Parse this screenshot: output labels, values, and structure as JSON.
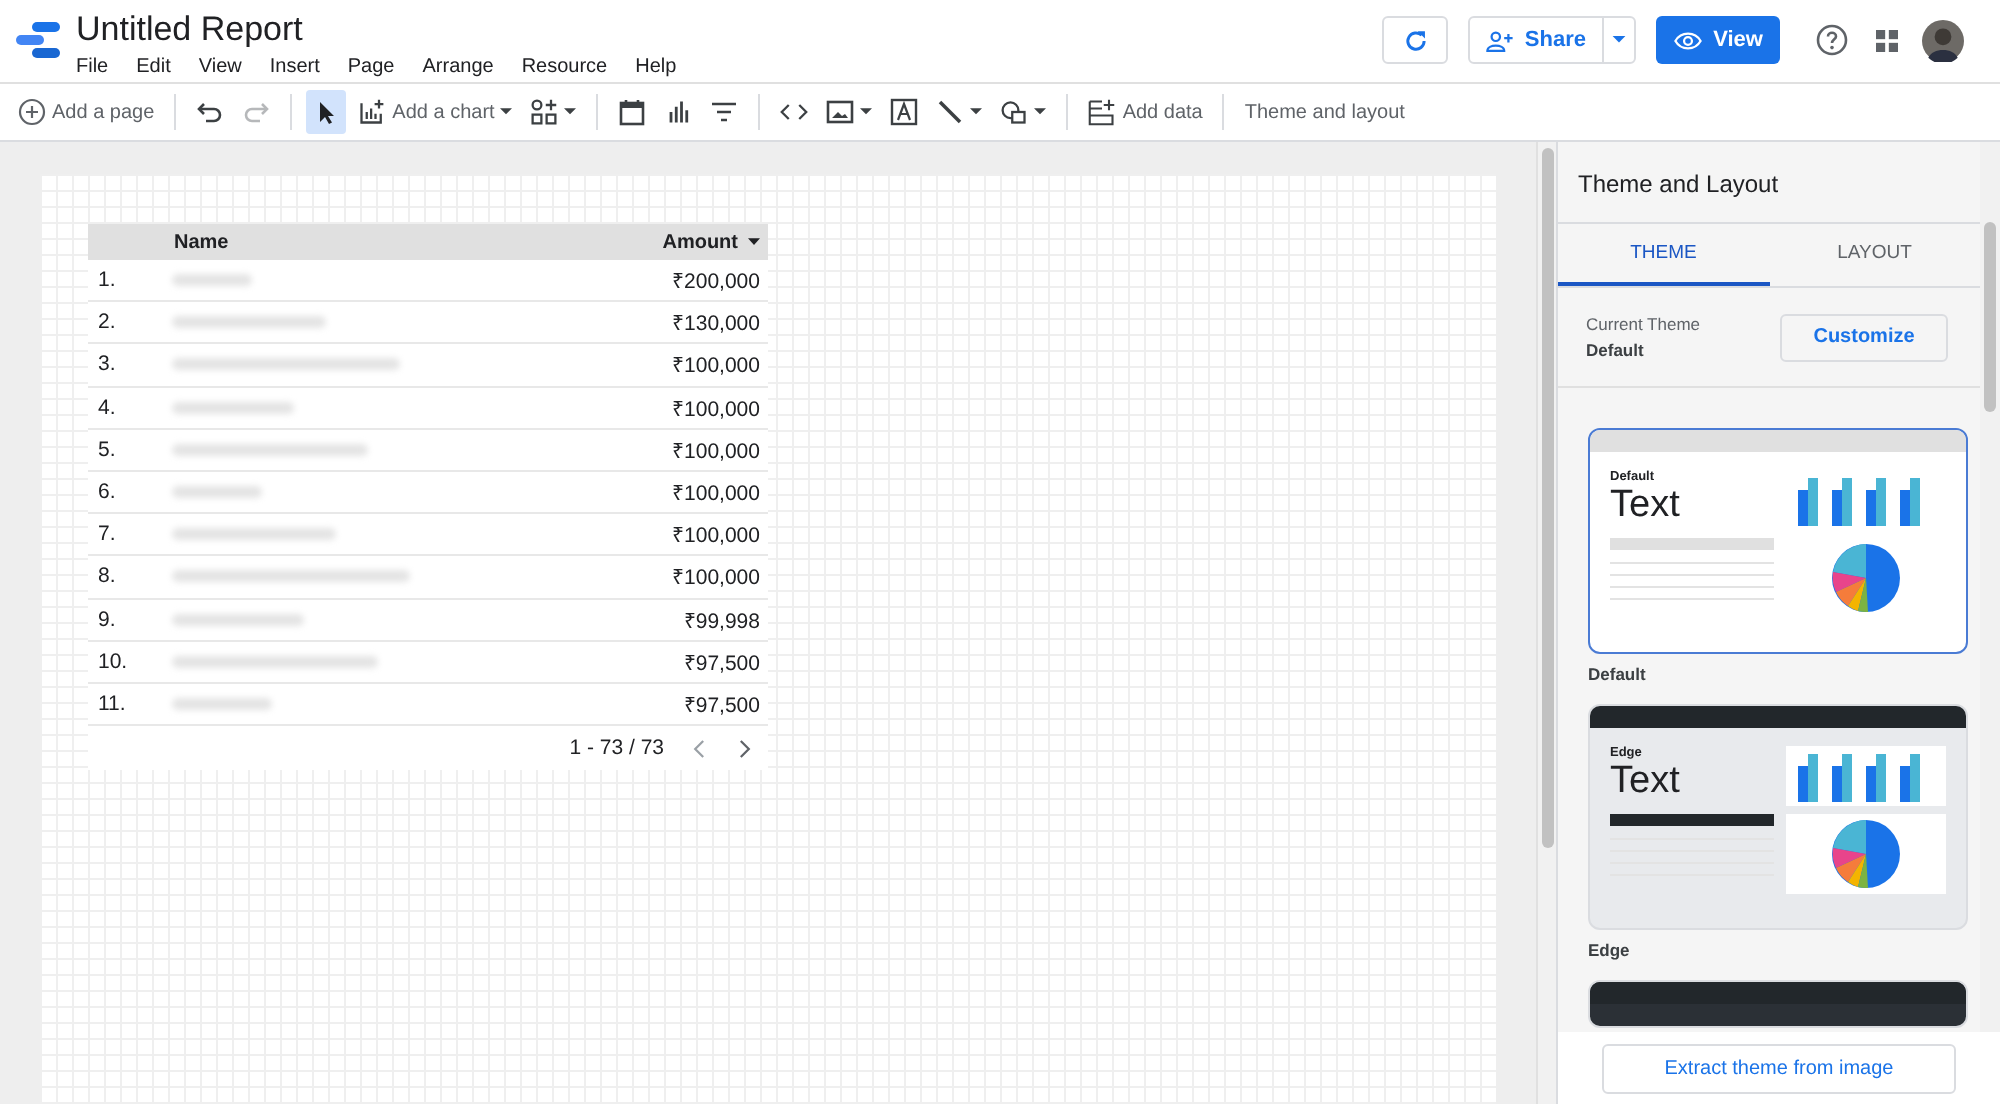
{
  "app": {
    "title": "Untitled Report",
    "menu": [
      "File",
      "Edit",
      "View",
      "Insert",
      "Page",
      "Arrange",
      "Resource",
      "Help"
    ]
  },
  "header_actions": [
    {
      "kind": "refresh"
    },
    {
      "kind": "share",
      "label": "Share"
    },
    {
      "kind": "view",
      "label": "View"
    },
    {
      "kind": "help"
    },
    {
      "kind": "apps"
    },
    {
      "kind": "avatar"
    }
  ],
  "toolbar": [
    {
      "kind": "addpage",
      "label": "Add a page",
      "selected": false,
      "disabled": false
    },
    {
      "kind": "separator"
    },
    {
      "kind": "undo",
      "selected": false,
      "disabled": false
    },
    {
      "kind": "redo",
      "selected": false,
      "disabled": true
    },
    {
      "kind": "separator"
    },
    {
      "kind": "select",
      "selected": true,
      "disabled": false
    },
    {
      "kind": "chart",
      "label": "Add a chart",
      "selected": false,
      "disabled": false
    },
    {
      "kind": "controls",
      "selected": false,
      "disabled": false
    },
    {
      "kind": "separator"
    },
    {
      "kind": "date",
      "selected": false,
      "disabled": false
    },
    {
      "kind": "sort",
      "selected": false,
      "disabled": false
    },
    {
      "kind": "filter",
      "selected": false,
      "disabled": false
    },
    {
      "kind": "separator"
    },
    {
      "kind": "code",
      "selected": false,
      "disabled": false
    },
    {
      "kind": "image",
      "selected": false,
      "disabled": false
    },
    {
      "kind": "textbox",
      "selected": false,
      "disabled": false
    },
    {
      "kind": "line",
      "selected": false,
      "disabled": false
    },
    {
      "kind": "shape",
      "selected": false,
      "disabled": false
    },
    {
      "kind": "separator"
    },
    {
      "kind": "adddata",
      "label": "Add data",
      "selected": false,
      "disabled": false
    },
    {
      "kind": "separator"
    },
    {
      "kind": "plain",
      "label": "Theme and layout",
      "selected": false,
      "disabled": false
    }
  ],
  "table": {
    "columns": [
      {
        "label": "Name",
        "sorted": false
      },
      {
        "label": "Amount",
        "sorted": true
      }
    ],
    "rows": [
      {
        "index": "1.",
        "amount": "₹200,000"
      },
      {
        "index": "2.",
        "amount": "₹130,000"
      },
      {
        "index": "3.",
        "amount": "₹100,000"
      },
      {
        "index": "4.",
        "amount": "₹100,000"
      },
      {
        "index": "5.",
        "amount": "₹100,000"
      },
      {
        "index": "6.",
        "amount": "₹100,000"
      },
      {
        "index": "7.",
        "amount": "₹100,000"
      },
      {
        "index": "8.",
        "amount": "₹100,000"
      },
      {
        "index": "9.",
        "amount": "₹99,998"
      },
      {
        "index": "10.",
        "amount": "₹97,500"
      },
      {
        "index": "11.",
        "amount": "₹97,500"
      }
    ],
    "pagination": "1 - 73 / 73"
  },
  "panel": {
    "title": "Theme and Layout",
    "tabs": [
      {
        "label": "THEME",
        "selected": true
      },
      {
        "label": "LAYOUT",
        "selected": false
      }
    ],
    "current_theme": {
      "label": "Current Theme",
      "value": "Default"
    },
    "customize_button": "Customize",
    "themes": [
      {
        "kind": "light",
        "heading": "Default",
        "sample": "Text",
        "label": "Default",
        "selected": true
      },
      {
        "kind": "edge",
        "heading": "Edge",
        "sample": "Text",
        "label": "Edge",
        "selected": false
      },
      {
        "kind": "dark",
        "selected": false
      }
    ],
    "footer_button": "Extract theme from image"
  }
}
